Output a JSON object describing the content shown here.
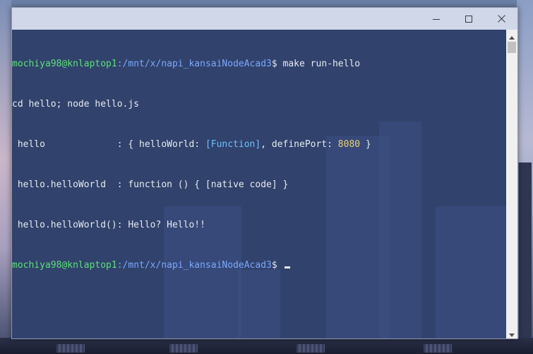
{
  "window": {
    "title": "",
    "controls": {
      "minimize_icon": "minimize-icon",
      "maximize_icon": "maximize-icon",
      "close_icon": "close-icon"
    }
  },
  "terminal": {
    "prompt_user_host": "mochiya98@knlaptop1",
    "prompt_path": ":/mnt/x/napi_kansaiNodeAcad3",
    "prompt_symbol": "$ ",
    "command": "make run-hello",
    "line2": "cd hello; node hello.js",
    "line3_prefix": " hello             : { helloWorld: ",
    "line3_function": "[Function]",
    "line3_middle": ", definePort: ",
    "line3_port": "8080",
    "line3_suffix": " }",
    "line4": " hello.helloWorld  : function () { [native code] }",
    "line5": " hello.helloWorld(): Hello? Hello!!",
    "colors": {
      "user": "#5ce07a",
      "path": "#7aa8ff",
      "function": "#6ec0ff",
      "number": "#e8d274",
      "text": "#e6e9f0"
    }
  },
  "scrollbar": {
    "up_icon": "chevron-up-icon",
    "down_icon": "chevron-down-icon"
  }
}
